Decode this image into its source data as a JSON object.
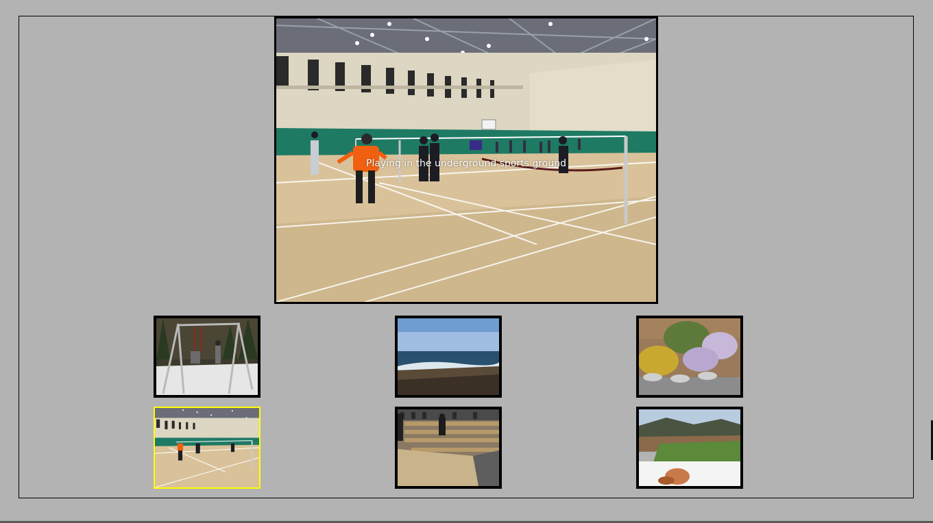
{
  "gallery": {
    "main": {
      "caption": "Playing in the underground sports ground",
      "image": "indoor-badminton-gym"
    },
    "thumbnails": [
      {
        "image": "snowy-playground-swings",
        "selected": false
      },
      {
        "image": "ocean-beach",
        "selected": false
      },
      {
        "image": "flower-bed",
        "selected": false
      },
      {
        "image": "indoor-badminton-gym",
        "selected": true
      },
      {
        "image": "cafeteria-tables",
        "selected": false
      },
      {
        "image": "stadium-view",
        "selected": false
      }
    ]
  },
  "colors": {
    "background": "#b3b3b3",
    "selected_border": "#ffff00",
    "thumb_border": "#000000"
  }
}
